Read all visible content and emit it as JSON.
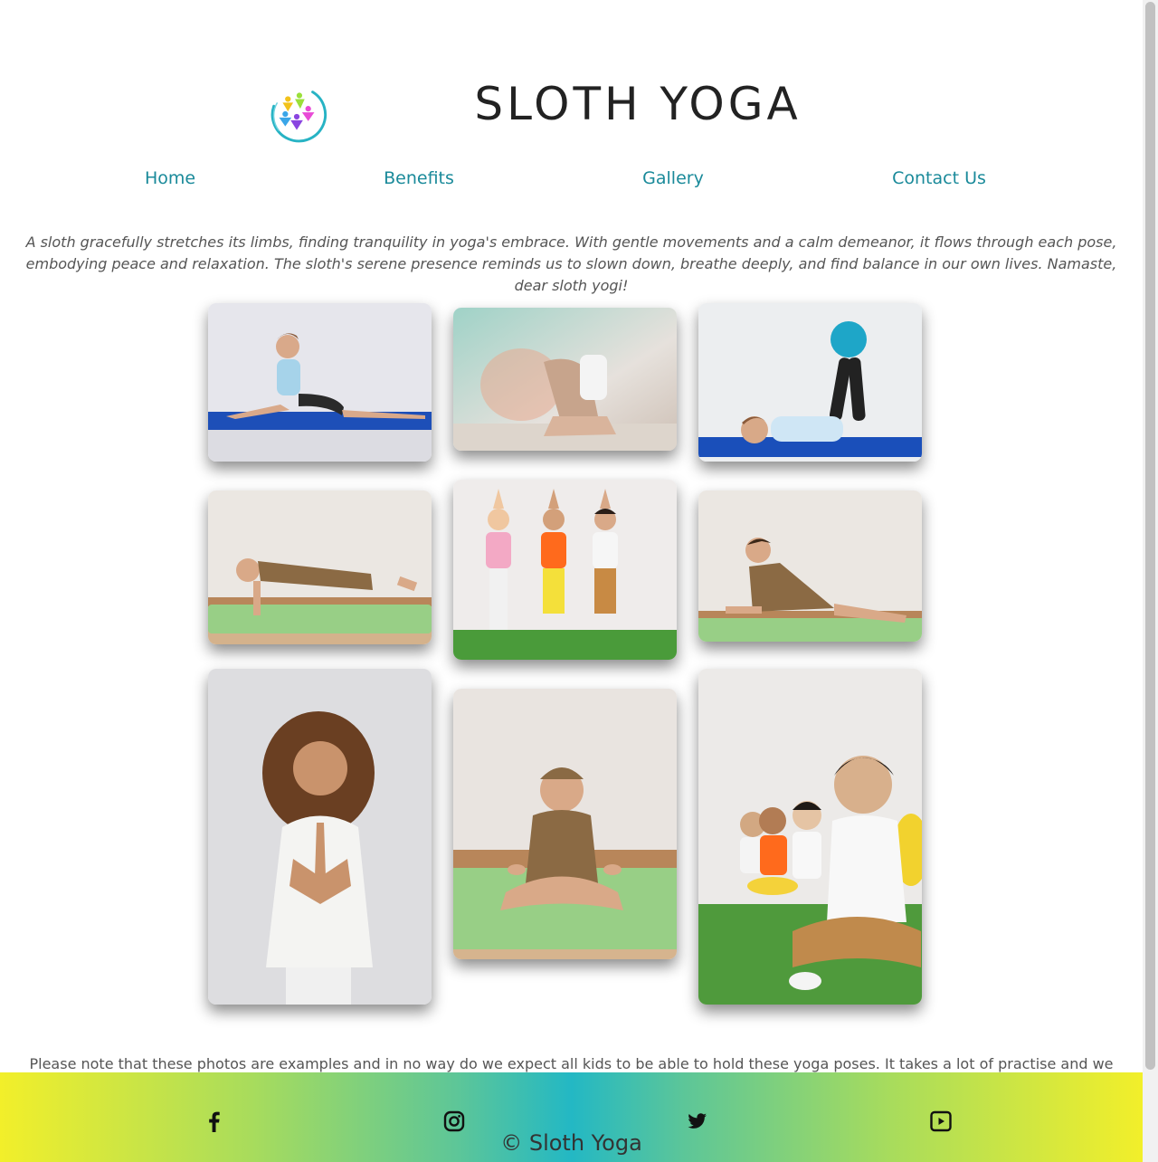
{
  "brand": {
    "title": "SLOTH YOGA",
    "logo_icon": "yoga-figures-logo",
    "colors": {
      "nav_link": "#1a8a9a",
      "gradient_edge": "#f2ef2a",
      "gradient_center": "#23b8c4"
    }
  },
  "nav": {
    "items": [
      {
        "label": "Home"
      },
      {
        "label": "Benefits"
      },
      {
        "label": "Gallery"
      },
      {
        "label": "Contact Us"
      }
    ]
  },
  "intro": {
    "text": "A sloth gracefully stretches its limbs, finding tranquility in yoga's embrace. With gentle movements and a calm demeanor, it flows through each pose, embodying peace and relaxation. The sloth's serene presence reminds us to slown down, breathe deeply, and find balance in our own lives. Namaste, dear sloth yogi!"
  },
  "gallery": {
    "photos": [
      {
        "subject": "girl-split-pose-photo"
      },
      {
        "subject": "girl-backbend-pose-photo"
      },
      {
        "subject": "girl-leg-raise-ball-photo"
      },
      {
        "subject": "boy-plank-pose-photo"
      },
      {
        "subject": "kids-tree-pose-photo"
      },
      {
        "subject": "boy-cobra-pose-photo"
      },
      {
        "subject": "girl-prayer-hands-photo"
      },
      {
        "subject": "boy-lotus-sitting-photo"
      },
      {
        "subject": "kids-meditating-group-photo"
      }
    ]
  },
  "note": {
    "text": "Please note that these photos are examples and in no way do we expect all kids to be able to hold these yoga poses. It takes a lot of practise and we encourage each to go at their own pace."
  },
  "footer": {
    "social": [
      {
        "icon": "facebook-icon"
      },
      {
        "icon": "instagram-icon"
      },
      {
        "icon": "twitter-icon"
      },
      {
        "icon": "youtube-icon"
      }
    ],
    "copyright": "© Sloth Yoga"
  }
}
